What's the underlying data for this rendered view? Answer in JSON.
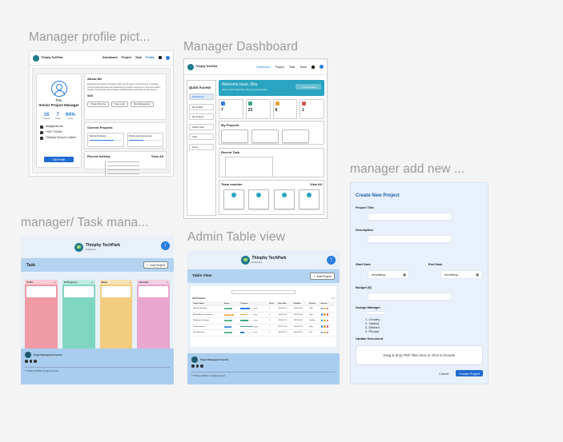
{
  "frames": {
    "profile": {
      "title": "Manager profile pict..."
    },
    "dashboard": {
      "title": "Manager Dashboard"
    },
    "task": {
      "title": "manager/ Task mana..."
    },
    "table": {
      "title": "Admin Table view"
    },
    "add": {
      "title": "manager add new ..."
    }
  },
  "profile": {
    "nav": [
      "Dashboard",
      "Project",
      "Task",
      "Profile"
    ],
    "name": "Ritu",
    "role": "Senior Project Manager",
    "stats": [
      {
        "value": "16",
        "label": "Projects"
      },
      {
        "value": "7",
        "label": "Tasks"
      },
      {
        "value": "94%",
        "label": "Goals"
      }
    ],
    "email": "ritu@gmail.com",
    "phone": "+919 7722494",
    "company": "Thinkphy Tech pvt. Limited",
    "edit_label": "Edit Profile",
    "about_title": "About Me",
    "skills_title": "Skill",
    "skills": [
      "Project Planning",
      "Team Lead",
      "Risk Management"
    ],
    "ongoing_title": "Ourrent Projects",
    "recent_title": "Recent Activity",
    "view_all": "View All"
  },
  "dashboard": {
    "nav": [
      "Dashboard",
      "Project",
      "Task",
      "Team"
    ],
    "quick_access": "Quick Access",
    "quick_items": [
      "Dashboard",
      "My Profile",
      "My Project",
      "Tasks View",
      "Task",
      "Team"
    ],
    "welcome": "Welcome back, Ritu",
    "welcome_button": "+ Create New",
    "stats": [
      {
        "value": "7",
        "color": "#2a7de1"
      },
      {
        "value": "23",
        "color": "#3aa57a"
      },
      {
        "value": "8",
        "color": "#e8a33a"
      },
      {
        "value": "1",
        "color": "#d9534f"
      }
    ],
    "my_projects": "My Projects",
    "recent_task": "Recent Task",
    "team_member": "Team member",
    "view_all": "View All"
  },
  "brand": {
    "name": "Thinphy TechPark",
    "sub": "Enterprise"
  },
  "task": {
    "bar_title": "Task",
    "add_button": "Add Project",
    "columns": [
      {
        "label": "To Do",
        "color": "#ef9aa4"
      },
      {
        "label": "In Progress",
        "color": "#7fd6c0"
      },
      {
        "label": "Done",
        "color": "#f2cd80"
      },
      {
        "label": "Overdue",
        "color": "#e9a6cf"
      }
    ],
    "footer_name": "Project Management System",
    "footer_copy": "© Thinphy TechPark. All rights reserved."
  },
  "table": {
    "bar_title": "Table View",
    "add_button": "Add Project",
    "all_projects": "All Projects",
    "headers": [
      "Project Name",
      "Status",
      "Progress",
      "Team",
      "Start Date",
      "Deadline",
      "Priority",
      "Actions"
    ],
    "rows": [
      {
        "name": "Website Redesign",
        "status": "Active",
        "status_color": "#3aa57a",
        "progress": 0.75,
        "bar_color": "#2a7de1",
        "pct": "75%",
        "team": "4",
        "start": "2025-01-10",
        "deadline": "2025-03-15",
        "priority": "High"
      },
      {
        "name": "Mobile App Development",
        "status": "Pending",
        "status_color": "#e8a33a",
        "progress": 0.45,
        "bar_color": "#e8a33a",
        "pct": "45%",
        "team": "6",
        "start": "2025-02-01",
        "deadline": "2025-05-30",
        "priority": "High"
      },
      {
        "name": "Marketing Campaign",
        "status": "Active",
        "status_color": "#3aa57a",
        "progress": 0.6,
        "bar_color": "#3aa57a",
        "pct": "60%",
        "team": "3",
        "start": "2025-01-20",
        "deadline": "2025-04-10",
        "priority": "Medium"
      },
      {
        "name": "Product Launch",
        "status": "Done",
        "status_color": "#2a7de1",
        "progress": 1,
        "bar_color": "#3aa57a",
        "pct": "100%",
        "team": "5",
        "start": "2024-11-05",
        "deadline": "2025-01-31",
        "priority": "High"
      },
      {
        "name": "Data Migration",
        "status": "Active",
        "status_color": "#3aa57a",
        "progress": 0.3,
        "bar_color": "#2a7de1",
        "pct": "30%",
        "team": "2",
        "start": "2025-02-15",
        "deadline": "2025-06-01",
        "priority": "Low"
      }
    ],
    "footer_name": "Project Management System",
    "footer_copy": "© Thinphy TechPark. All rights reserved."
  },
  "add": {
    "title": "Create New Project",
    "project_title": "Project Title",
    "description": "Description",
    "start_date": "Start Date",
    "end_date": "End Date",
    "date_placeholder": "mm/dd/yy",
    "budget": "Budget ($)",
    "assign_manager": "Assign Manager",
    "managers": [
      "1. Chodey",
      "2. Yashey",
      "3. Dilliram",
      "4. Phurpa"
    ],
    "update_document": "Update Document",
    "drop_text": "Drag & drop PDF files here or click to browse",
    "cancel": "Cancel",
    "create": "Create Project"
  }
}
